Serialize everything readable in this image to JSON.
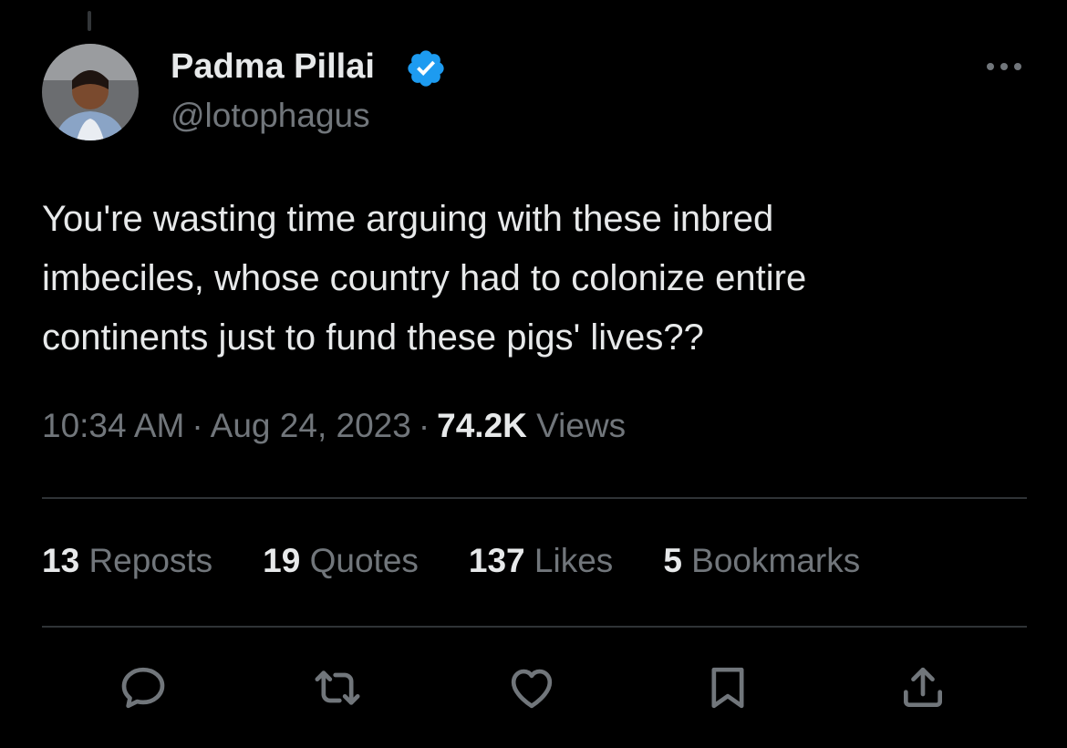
{
  "author": {
    "name": "Padma Pillai",
    "handle": "@lotophagus",
    "verified_color": "#1d9bf0"
  },
  "tweet": {
    "line1": "You're wasting time arguing with these inbred",
    "line2": "imbeciles, whose country had to colonize entire",
    "line3": "continents just to fund these pigs' lives??"
  },
  "meta": {
    "time": "10:34 AM",
    "separator": "·",
    "date": "Aug 24, 2023",
    "views_count": "74.2K",
    "views_label": "Views"
  },
  "stats": {
    "reposts_count": "13",
    "reposts_label": "Reposts",
    "quotes_count": "19",
    "quotes_label": "Quotes",
    "likes_count": "137",
    "likes_label": "Likes",
    "bookmarks_count": "5",
    "bookmarks_label": "Bookmarks"
  },
  "icons": {
    "more": "more-icon",
    "reply": "reply-icon",
    "repost": "repost-icon",
    "like": "heart-icon",
    "bookmark": "bookmark-icon",
    "share": "share-icon"
  },
  "colors": {
    "background": "#000000",
    "primary_text": "#e7e9ea",
    "secondary_text": "#71767b",
    "divider": "#2f3336",
    "accent": "#1d9bf0"
  }
}
